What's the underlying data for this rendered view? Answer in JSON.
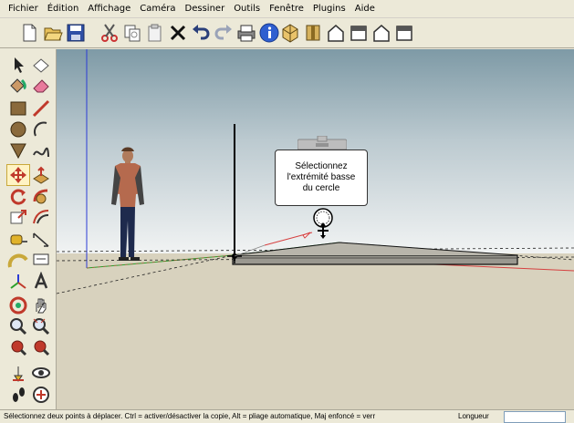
{
  "menubar": {
    "items": [
      "Fichier",
      "Édition",
      "Affichage",
      "Caméra",
      "Dessiner",
      "Outils",
      "Fenêtre",
      "Plugins",
      "Aide"
    ]
  },
  "toolbar": {
    "buttons": [
      "new-icon",
      "open-icon",
      "save-icon",
      "cut-icon",
      "copy-icon",
      "paste-icon",
      "erase-icon",
      "undo-icon",
      "redo-icon",
      "print-icon",
      "info-icon",
      "iso-view-icon",
      "top-view-icon",
      "front-view-icon",
      "right-view-icon",
      "back-view-icon"
    ]
  },
  "lefttools": {
    "tools": [
      "select",
      "make-component",
      "paint-bucket",
      "eraser",
      "rectangle",
      "line",
      "circle",
      "arc",
      "polygon",
      "freehand",
      "move",
      "push-pull",
      "rotate",
      "follow-me",
      "scale",
      "offset",
      "tape-measure",
      "dimension",
      "protractor",
      "text",
      "axes",
      "3d-text",
      "orbit",
      "pan",
      "zoom",
      "zoom-extents",
      "previous-view",
      "next-view",
      "position-camera",
      "look-around",
      "walk",
      "section-plane"
    ],
    "active": "move"
  },
  "tooltip": {
    "lines": [
      "Sélectionnez",
      "l'extrémité basse",
      "du cercle"
    ]
  },
  "statusbar": {
    "text": "Sélectionnez deux points à déplacer.  Ctrl = activer/désactiver la copie, Alt = pliage automatique, Maj enfoncé = verr",
    "measure_label": "Longueur",
    "measure_value": ""
  },
  "colors": {
    "sky_top": "#7e9aa6",
    "sky_bottom": "#eef1f1",
    "ground": "#d8d2be",
    "red_axis": "#d64040",
    "green_axis": "#2aa02a",
    "blue_axis": "#2b3bd6"
  }
}
